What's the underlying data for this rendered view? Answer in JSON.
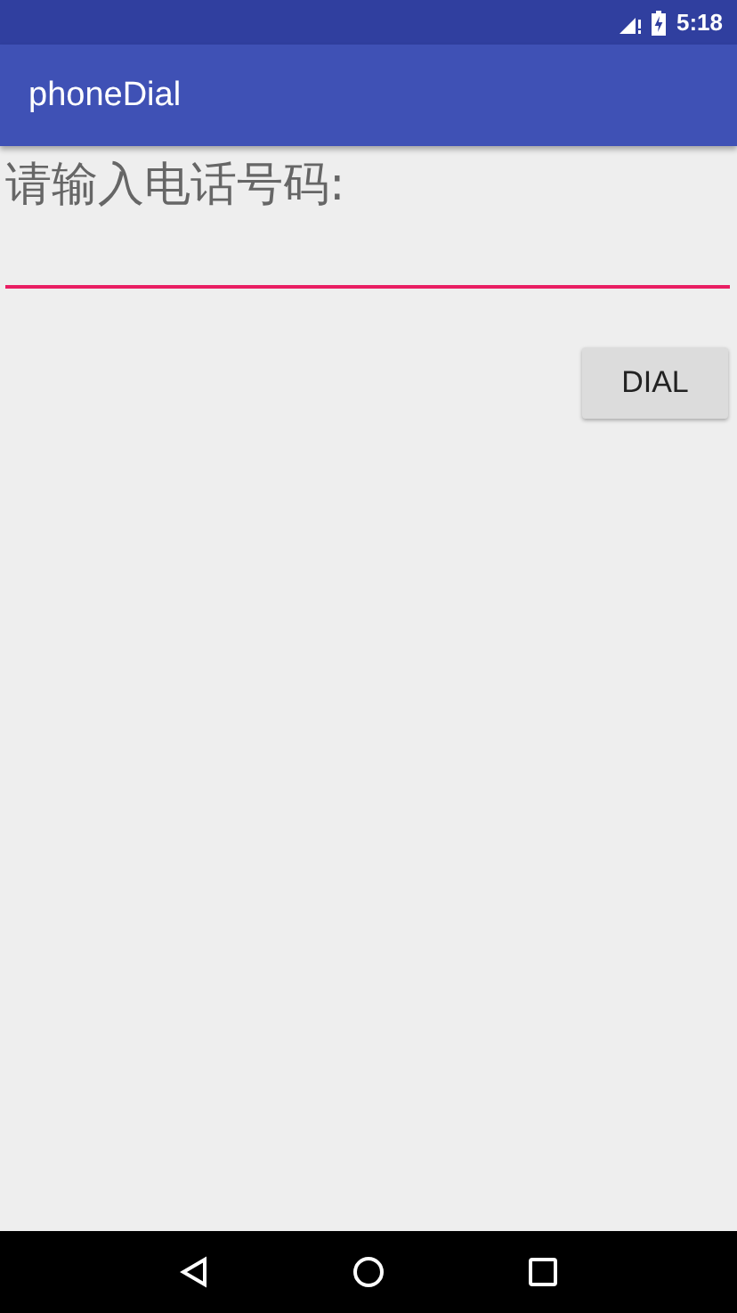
{
  "status_bar": {
    "time": "5:18"
  },
  "app_bar": {
    "title": "phoneDial"
  },
  "form": {
    "label": "请输入电话号码:",
    "phone_field": {
      "focused": true
    },
    "dial_button": "DIAL"
  }
}
